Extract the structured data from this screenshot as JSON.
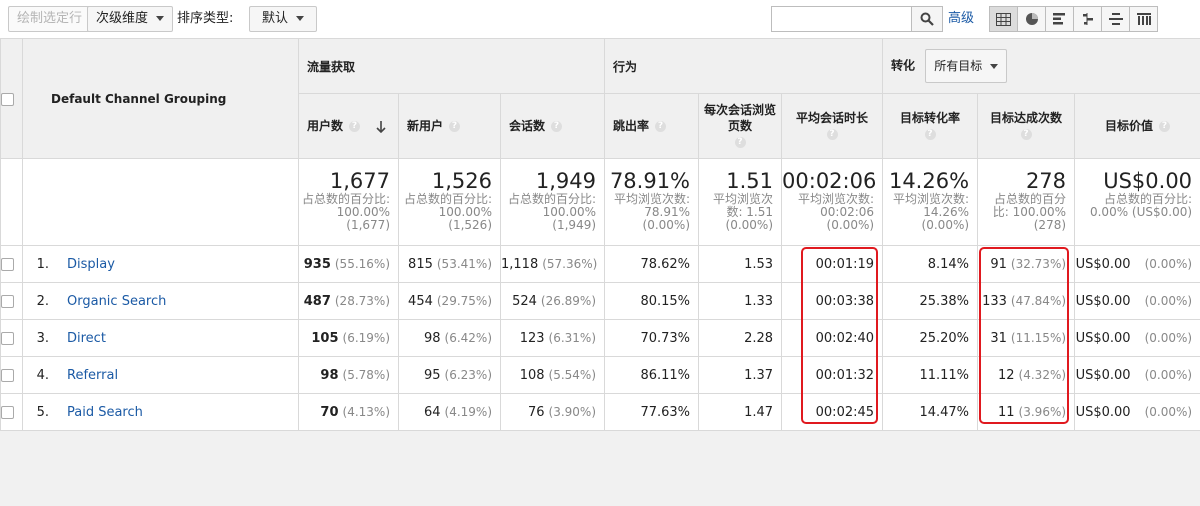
{
  "toolbar": {
    "plot_rows_label": "绘制选定行",
    "secondary_dimension_label": "次级维度",
    "sort_type_label": "排序类型:",
    "sort_type_value": "默认",
    "search_placeholder": "",
    "advanced_label": "高级",
    "view_icons": [
      "table-view-icon",
      "pie-view-icon",
      "performance-view-icon",
      "comparison-view-icon",
      "term-cloud-view-icon",
      "pivot-view-icon"
    ]
  },
  "table": {
    "dimension_header": "Default Channel Grouping",
    "groups": {
      "acquisition": "流量获取",
      "behavior": "行为",
      "conversion": "转化",
      "goal_select": "所有目标"
    },
    "columns": [
      "用户数",
      "新用户",
      "会话数",
      "跳出率",
      "每次会话浏览页数",
      "平均会话时长",
      "目标转化率",
      "目标达成次数",
      "目标价值"
    ],
    "totals": [
      {
        "value": "1,677",
        "sub": "占总数的百分比: 100.00% (1,677)"
      },
      {
        "value": "1,526",
        "sub": "占总数的百分比: 100.00% (1,526)"
      },
      {
        "value": "1,949",
        "sub": "占总数的百分比: 100.00% (1,949)"
      },
      {
        "value": "78.91%",
        "sub": "平均浏览次数: 78.91% (0.00%)"
      },
      {
        "value": "1.51",
        "sub": "平均浏览次数: 1.51 (0.00%)"
      },
      {
        "value": "00:02:06",
        "sub": "平均浏览次数: 00:02:06 (0.00%)"
      },
      {
        "value": "14.26%",
        "sub": "平均浏览次数: 14.26% (0.00%)"
      },
      {
        "value": "278",
        "sub": "占总数的百分比: 100.00% (278)"
      },
      {
        "value": "US$0.00",
        "sub": "占总数的百分比: 0.00% (US$0.00)"
      }
    ],
    "rows": [
      {
        "index": "1.",
        "name": "Display",
        "users": "935",
        "users_pct": "(55.16%)",
        "new_users": "815",
        "new_users_pct": "(53.41%)",
        "sessions": "1,118",
        "sessions_pct": "(57.36%)",
        "bounce": "78.62%",
        "pages": "1.53",
        "duration": "00:01:19",
        "conv_rate": "8.14%",
        "completions": "91",
        "completions_pct": "(32.73%)",
        "value": "US$0.00",
        "value_pct": "(0.00%)"
      },
      {
        "index": "2.",
        "name": "Organic Search",
        "users": "487",
        "users_pct": "(28.73%)",
        "new_users": "454",
        "new_users_pct": "(29.75%)",
        "sessions": "524",
        "sessions_pct": "(26.89%)",
        "bounce": "80.15%",
        "pages": "1.33",
        "duration": "00:03:38",
        "conv_rate": "25.38%",
        "completions": "133",
        "completions_pct": "(47.84%)",
        "value": "US$0.00",
        "value_pct": "(0.00%)"
      },
      {
        "index": "3.",
        "name": "Direct",
        "users": "105",
        "users_pct": "(6.19%)",
        "new_users": "98",
        "new_users_pct": "(6.42%)",
        "sessions": "123",
        "sessions_pct": "(6.31%)",
        "bounce": "70.73%",
        "pages": "2.28",
        "duration": "00:02:40",
        "conv_rate": "25.20%",
        "completions": "31",
        "completions_pct": "(11.15%)",
        "value": "US$0.00",
        "value_pct": "(0.00%)"
      },
      {
        "index": "4.",
        "name": "Referral",
        "users": "98",
        "users_pct": "(5.78%)",
        "new_users": "95",
        "new_users_pct": "(6.23%)",
        "sessions": "108",
        "sessions_pct": "(5.54%)",
        "bounce": "86.11%",
        "pages": "1.37",
        "duration": "00:01:32",
        "conv_rate": "11.11%",
        "completions": "12",
        "completions_pct": "(4.32%)",
        "value": "US$0.00",
        "value_pct": "(0.00%)"
      },
      {
        "index": "5.",
        "name": "Paid Search",
        "users": "70",
        "users_pct": "(4.13%)",
        "new_users": "64",
        "new_users_pct": "(4.19%)",
        "sessions": "76",
        "sessions_pct": "(3.90%)",
        "bounce": "77.63%",
        "pages": "1.47",
        "duration": "00:02:45",
        "conv_rate": "14.47%",
        "completions": "11",
        "completions_pct": "(3.96%)",
        "value": "US$0.00",
        "value_pct": "(0.00%)"
      }
    ]
  },
  "colors": {
    "link": "#1b5aa5",
    "highlight": "#e0191f",
    "header_bg": "#f0f0f0"
  }
}
